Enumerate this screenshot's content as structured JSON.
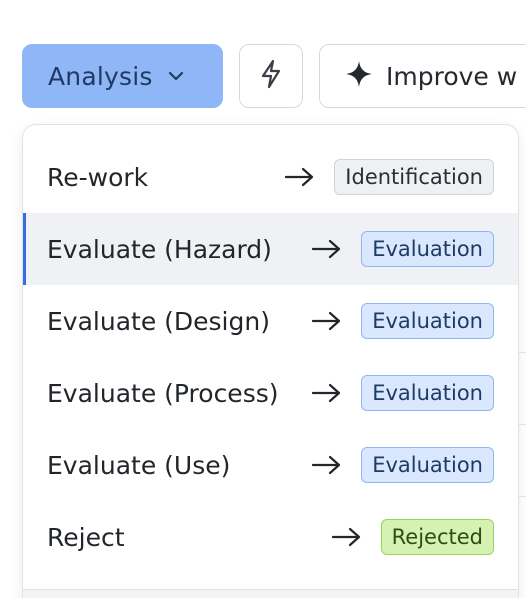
{
  "toolbar": {
    "analysis_label": "Analysis",
    "improve_label": "Improve w"
  },
  "icons": {
    "analysis_chevron": "chevron-down-icon",
    "bolt": "lightning-icon",
    "sparkle": "sparkle-icon",
    "arrow": "arrow-right-icon"
  },
  "menu": {
    "items": [
      {
        "label": "Re-work",
        "badge": "Identification",
        "badge_type": "identification",
        "active": false
      },
      {
        "label": "Evaluate (Hazard)",
        "badge": "Evaluation",
        "badge_type": "evaluation",
        "active": true
      },
      {
        "label": "Evaluate (Design)",
        "badge": "Evaluation",
        "badge_type": "evaluation",
        "active": false
      },
      {
        "label": "Evaluate (Process)",
        "badge": "Evaluation",
        "badge_type": "evaluation",
        "active": false
      },
      {
        "label": "Evaluate (Use)",
        "badge": "Evaluation",
        "badge_type": "evaluation",
        "active": false
      },
      {
        "label": "Reject",
        "badge": "Rejected",
        "badge_type": "rejected",
        "active": false
      }
    ]
  },
  "colors": {
    "primary_button": "#8fb6f7",
    "active_indicator": "#2f6fe0",
    "evaluation_badge": "#d9e8fe",
    "rejected_badge": "#d6f2b3",
    "identification_badge": "#eef0f3"
  }
}
